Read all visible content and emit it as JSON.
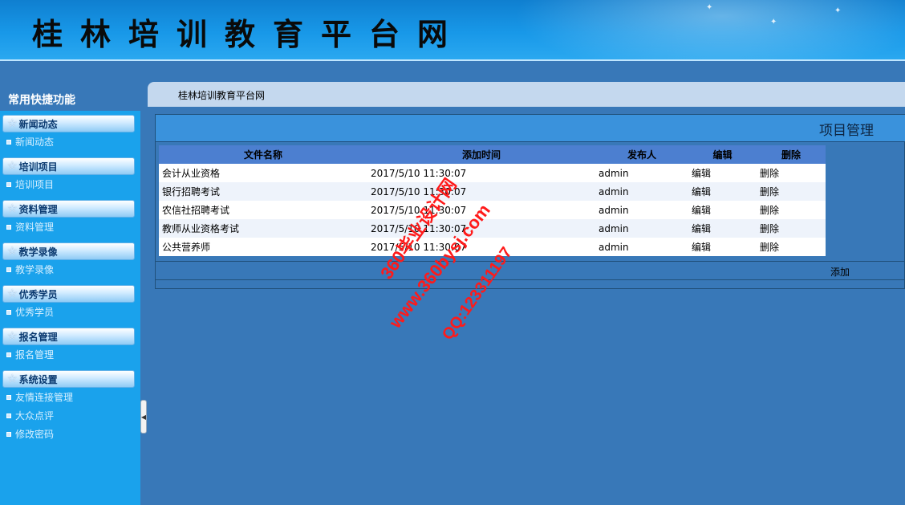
{
  "header": {
    "site_title": "桂林培训教育平台网"
  },
  "sidebar": {
    "heading": "常用快捷功能",
    "groups": [
      {
        "title": "新闻动态",
        "items": [
          "新闻动态"
        ]
      },
      {
        "title": "培训项目",
        "items": [
          "培训项目"
        ]
      },
      {
        "title": "资料管理",
        "items": [
          "资料管理"
        ]
      },
      {
        "title": "教学录像",
        "items": [
          "教学录像"
        ]
      },
      {
        "title": "优秀学员",
        "items": [
          "优秀学员"
        ]
      },
      {
        "title": "报名管理",
        "items": [
          "报名管理"
        ]
      },
      {
        "title": "系统设置",
        "items": [
          "友情连接管理",
          "大众点评",
          "修改密码"
        ]
      }
    ]
  },
  "breadcrumb": {
    "text": "桂林培训教育平台网"
  },
  "panel": {
    "title": "项目管理",
    "columns": [
      "文件名称",
      "添加时间",
      "发布人",
      "编辑",
      "删除"
    ],
    "rows": [
      {
        "name": "会计从业资格",
        "time": "2017/5/10 11:30:07",
        "author": "admin",
        "edit": "编辑",
        "delete": "删除"
      },
      {
        "name": "银行招聘考试",
        "time": "2017/5/10 11:30:07",
        "author": "admin",
        "edit": "编辑",
        "delete": "删除"
      },
      {
        "name": "农信社招聘考试",
        "time": "2017/5/10 11:30:07",
        "author": "admin",
        "edit": "编辑",
        "delete": "删除"
      },
      {
        "name": "教师从业资格考试",
        "time": "2017/5/10 11:30:07",
        "author": "admin",
        "edit": "编辑",
        "delete": "删除"
      },
      {
        "name": "公共营养师",
        "time": "2017/5/10 11:30:07",
        "author": "admin",
        "edit": "编辑",
        "delete": "删除"
      }
    ],
    "add_label": "添加"
  },
  "watermark": {
    "line1": "360毕业设计网",
    "line2": "www.360bysj.com",
    "line3": "QQ:123311197",
    "color": "#ff1a1a"
  },
  "colors": {
    "header_bg": "#1898e8",
    "sidebar_bg": "#1aa2ec",
    "body_bg": "#3878b8",
    "table_header_bg": "#4c7fd0"
  }
}
